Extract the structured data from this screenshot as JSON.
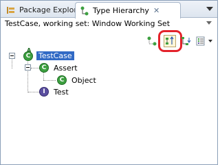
{
  "tabs": [
    {
      "label": "Package Explorer",
      "icon": "package-explorer-icon",
      "active": false
    },
    {
      "label": "Type Hierarchy",
      "icon": "type-hierarchy-icon",
      "active": true,
      "close": "✕"
    }
  ],
  "status": {
    "text": "TestCase, working set: Window Working Set"
  },
  "toolbar": {
    "buttons": [
      {
        "name": "show-type-hierarchy-button",
        "icon": "type-hierarchy-icon"
      },
      {
        "name": "show-supertype-hierarchy-button",
        "icon": "supertype-hierarchy-icon",
        "highlighted": true
      },
      {
        "name": "show-subtype-hierarchy-button",
        "icon": "subtype-hierarchy-icon"
      },
      {
        "name": "history-list-button",
        "icon": "list-icon"
      }
    ],
    "highlight_color": "#e3222a"
  },
  "tree": {
    "root": {
      "label": "TestCase",
      "icon": "class-icon",
      "badge": "A",
      "selected": true
    },
    "children": [
      {
        "label": "Assert",
        "icon": "class-icon",
        "children": [
          {
            "label": "Object",
            "icon": "class-icon"
          }
        ]
      },
      {
        "label": "Test",
        "icon": "interface-icon"
      }
    ]
  },
  "icon_glyphs": {
    "class": "C",
    "interface": "I",
    "abstract": "A"
  },
  "colors": {
    "selection": "#316ac5",
    "class_icon": "#3da040",
    "interface_icon": "#5b4fa0"
  }
}
